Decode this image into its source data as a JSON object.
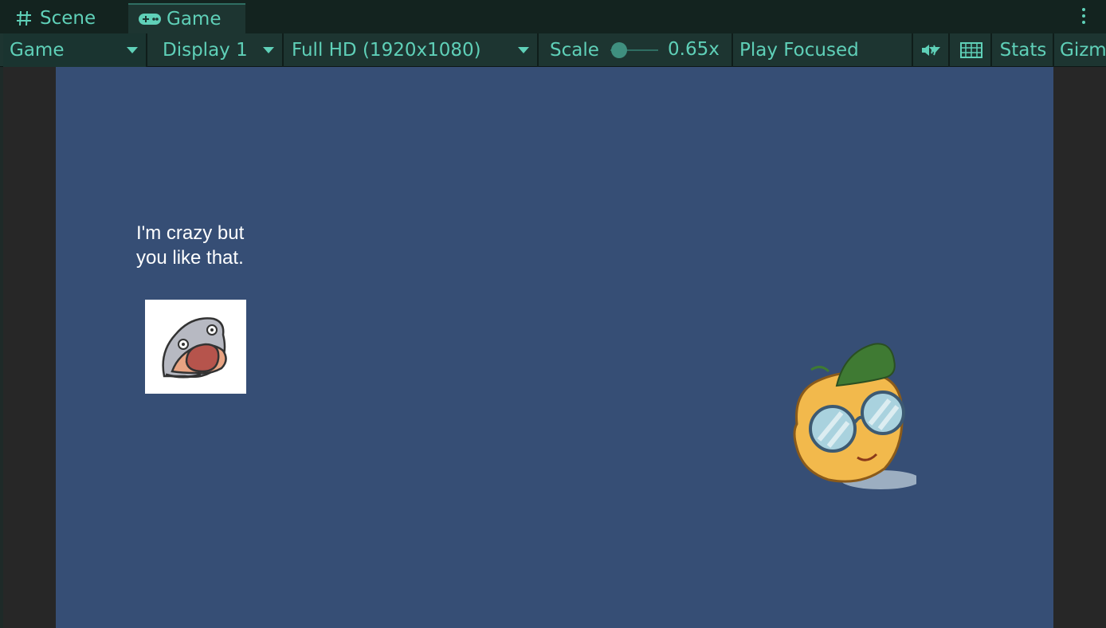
{
  "tabs": {
    "scene_label": "Scene",
    "game_label": "Game",
    "scene_icon": "hash-icon",
    "game_icon": "gamepad-icon"
  },
  "toolbar": {
    "view_mode": "Game",
    "display": "Display 1",
    "resolution": "Full HD (1920x1080)",
    "scale_label": "Scale",
    "scale_value": "0.65x",
    "play_mode": "Play Focused",
    "audio_icon": "speaker-icon",
    "keyboard_icon": "keyboard-icon",
    "stats_label": "Stats",
    "gizmos_label": "Gizm"
  },
  "game": {
    "dialog_line1": "I'm crazy but",
    "dialog_line2": "you like that.",
    "background_color": "#364e75"
  },
  "colors": {
    "accent": "#5fd0b8",
    "toolbar_bg": "#1d3531",
    "tabbar_bg": "#13231f"
  }
}
